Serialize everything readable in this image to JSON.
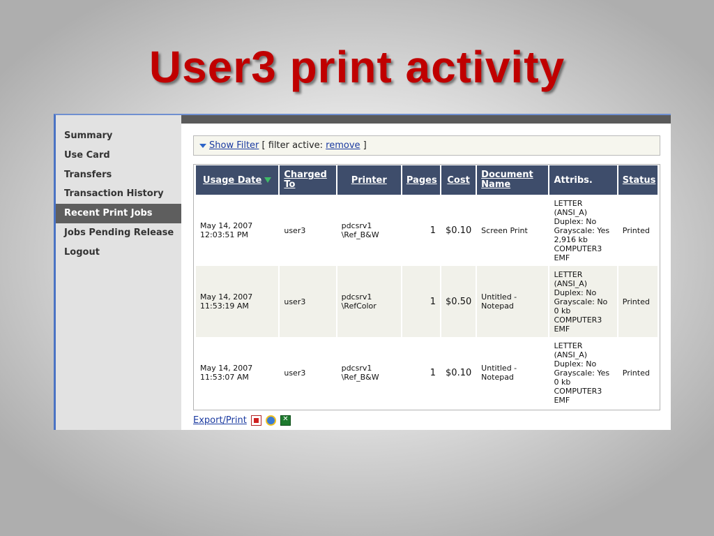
{
  "slide": {
    "title": "User3 print activity"
  },
  "sidebar": {
    "items": [
      {
        "label": "Summary"
      },
      {
        "label": "Use Card"
      },
      {
        "label": "Transfers"
      },
      {
        "label": "Transaction History"
      },
      {
        "label": "Recent Print Jobs",
        "active": true
      },
      {
        "label": "Jobs Pending Release"
      },
      {
        "label": "Logout"
      }
    ]
  },
  "filter": {
    "show_label": "Show Filter",
    "active_prefix": "[ filter active: ",
    "remove_label": "remove",
    "active_suffix": " ]"
  },
  "table": {
    "headers": {
      "usage_date": "Usage Date",
      "charged_to": "Charged To",
      "printer": "Printer",
      "pages": "Pages",
      "cost": "Cost",
      "document_name": "Document Name",
      "attribs": "Attribs.",
      "status": "Status"
    },
    "rows": [
      {
        "usage_date": "May 14, 2007\n12:03:51 PM",
        "charged_to": "user3",
        "printer": "pdcsrv1\n\\Ref_B&W",
        "pages": "1",
        "cost": "$0.10",
        "document_name": "Screen Print",
        "attribs": "LETTER\n(ANSI_A)\nDuplex: No\nGrayscale: Yes\n2,916 kb\nCOMPUTER3\nEMF",
        "status": "Printed"
      },
      {
        "usage_date": "May 14, 2007\n11:53:19 AM",
        "charged_to": "user3",
        "printer": "pdcsrv1\n\\RefColor",
        "pages": "1",
        "cost": "$0.50",
        "document_name": "Untitled -\nNotepad",
        "attribs": "LETTER\n(ANSI_A)\nDuplex: No\nGrayscale: No\n0 kb\nCOMPUTER3\nEMF",
        "status": "Printed"
      },
      {
        "usage_date": "May 14, 2007\n11:53:07 AM",
        "charged_to": "user3",
        "printer": "pdcsrv1\n\\Ref_B&W",
        "pages": "1",
        "cost": "$0.10",
        "document_name": "Untitled -\nNotepad",
        "attribs": "LETTER\n(ANSI_A)\nDuplex: No\nGrayscale: Yes\n0 kb\nCOMPUTER3\nEMF",
        "status": "Printed"
      }
    ]
  },
  "export": {
    "label": "Export/Print",
    "icons": [
      "pdf-icon",
      "ie-icon",
      "excel-icon"
    ]
  },
  "colors": {
    "title": "#c00000",
    "header_bg": "#3e4d6b",
    "nav_active": "#5e5e5e",
    "link": "#1a3aa0"
  }
}
